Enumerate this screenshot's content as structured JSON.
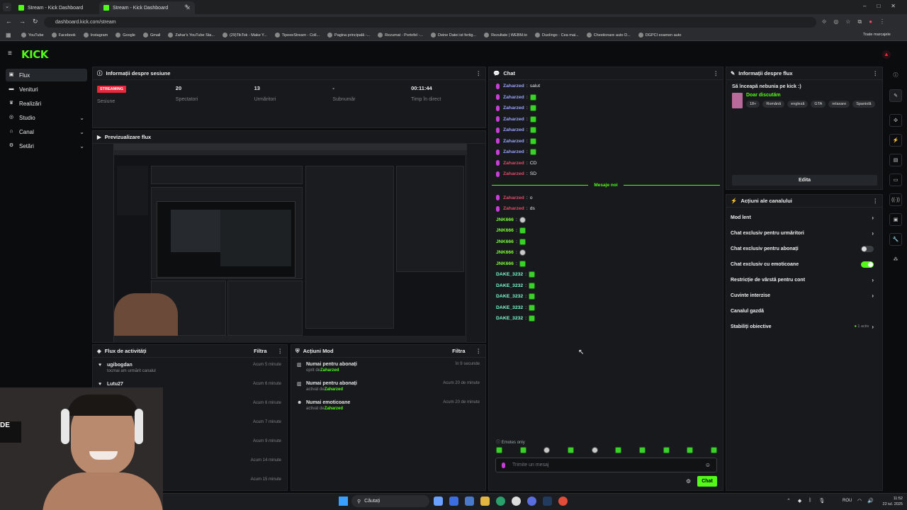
{
  "browser": {
    "tabs": [
      {
        "title": "Stream - Kick Dashboard"
      },
      {
        "title": "Stream - Kick Dashboard"
      }
    ],
    "url": "dashboard.kick.com/stream",
    "bookmarks": [
      "YouTube",
      "Facebook",
      "Instagram",
      "Google",
      "Gmail",
      "Zahar's YouTube Sta...",
      "(29)TikTok - Make Y...",
      "TipeeeStream - Coll...",
      "Pagina principală -...",
      "Rezumat - Portofel -...",
      "Deine Datei ist fertig...",
      "Rezultate | WEBM.to",
      "Duolingo - Cea mai...",
      "Chestionare auto D...",
      "DGPCI examen auto"
    ],
    "all_bookmarks": "Toate marcajele"
  },
  "logo": "KICK",
  "sidebar": [
    {
      "label": "Flux",
      "icon": "stream-icon",
      "active": true,
      "expand": false
    },
    {
      "label": "Venituri",
      "icon": "wallet-icon",
      "active": false,
      "expand": false
    },
    {
      "label": "Realizări",
      "icon": "trophy-icon",
      "active": false,
      "expand": false
    },
    {
      "label": "Studio",
      "icon": "studio-icon",
      "active": false,
      "expand": true
    },
    {
      "label": "Canal",
      "icon": "channel-icon",
      "active": false,
      "expand": true
    },
    {
      "label": "Setări",
      "icon": "gear-icon",
      "active": false,
      "expand": true
    }
  ],
  "session": {
    "title": "Informații despre sesiune",
    "status": "STREAMING",
    "status_label": "Sesiune",
    "viewers": "20",
    "viewers_label": "Spectatori",
    "followers": "13",
    "followers_label": "Urmăritori",
    "subs": "-",
    "subs_label": "Subnumăr",
    "time": "00:11:44",
    "time_label": "Timp în direct"
  },
  "preview": {
    "title": "Previzualizare flux"
  },
  "activity": {
    "title": "Flux de activități",
    "filter": "Filtra",
    "items": [
      {
        "user": "ugibogdan",
        "desc": "tocmai am urmărit canalul",
        "time": "Acum 5 minute"
      },
      {
        "user": "Lutu27",
        "desc": "",
        "time": "Acum 6 minute"
      },
      {
        "user": "",
        "desc": "",
        "time": "Acum 6 minute"
      },
      {
        "user": "",
        "desc": "",
        "time": "Acum 7 minute"
      },
      {
        "user": "",
        "desc": "",
        "time": "Acum 9 minute"
      },
      {
        "user": "",
        "desc": "",
        "time": "Acum 14 minute"
      },
      {
        "user": "",
        "desc": "",
        "time": "Acum 15 minute"
      }
    ]
  },
  "mod": {
    "title": "Acțiuni Mod",
    "filter": "Filtra",
    "items": [
      {
        "action": "Numai pentru abonați",
        "state": "oprit de",
        "by": "Zaharzed",
        "time": "în 9 secunde",
        "icon": "gift-icon"
      },
      {
        "action": "Numai pentru abonați",
        "state": "activat de",
        "by": "Zaharzed",
        "time": "Acum 20 de minute",
        "icon": "gift-icon"
      },
      {
        "action": "Numai emoticoane",
        "state": "activat de",
        "by": "Zaharzed",
        "time": "Acum 20 de minute",
        "icon": "smile-icon"
      }
    ]
  },
  "chat": {
    "title": "Chat",
    "new_messages": "Mesaje noi",
    "messages": [
      {
        "user": "Zaharzed",
        "color": "#9aa3ff",
        "text": "salut",
        "emote": "",
        "mic": true
      },
      {
        "user": "Zaharzed",
        "color": "#9aa3ff",
        "text": "",
        "emote": "frog",
        "mic": true
      },
      {
        "user": "Zaharzed",
        "color": "#9aa3ff",
        "text": "",
        "emote": "frog",
        "mic": true
      },
      {
        "user": "Zaharzed",
        "color": "#9aa3ff",
        "text": "",
        "emote": "frog",
        "mic": true
      },
      {
        "user": "Zaharzed",
        "color": "#9aa3ff",
        "text": "",
        "emote": "frog",
        "mic": true
      },
      {
        "user": "Zaharzed",
        "color": "#9aa3ff",
        "text": "",
        "emote": "frog",
        "mic": true
      },
      {
        "user": "Zaharzed",
        "color": "#9aa3ff",
        "text": "",
        "emote": "frog",
        "mic": true
      },
      {
        "user": "Zaharzed",
        "color": "#e24c6a",
        "text": "CD",
        "emote": "",
        "mic": true
      },
      {
        "user": "Zaharzed",
        "color": "#e24c6a",
        "text": "SD",
        "emote": "",
        "mic": true
      }
    ],
    "messages_after": [
      {
        "user": "Zaharzed",
        "color": "#e24c6a",
        "text": "o",
        "emote": "",
        "mic": true
      },
      {
        "user": "Zaharzed",
        "color": "#e24c6a",
        "text": "ds",
        "emote": "",
        "mic": true
      },
      {
        "user": "JNK666",
        "color": "#7dff3a",
        "text": "",
        "emote": "ball",
        "mic": false
      },
      {
        "user": "JNK666",
        "color": "#7dff3a",
        "text": "",
        "emote": "frog",
        "mic": false
      },
      {
        "user": "JNK666",
        "color": "#7dff3a",
        "text": "",
        "emote": "frog",
        "mic": false
      },
      {
        "user": "JNK666",
        "color": "#7dff3a",
        "text": "",
        "emote": "ball",
        "mic": false
      },
      {
        "user": "JNK666",
        "color": "#7dff3a",
        "text": "",
        "emote": "frog",
        "mic": false
      },
      {
        "user": "DAKE_3232",
        "color": "#7dffd0",
        "text": "",
        "emote": "frog",
        "mic": false
      },
      {
        "user": "DAKE_3232",
        "color": "#7dffd0",
        "text": "",
        "emote": "frog",
        "mic": false
      },
      {
        "user": "DAKE_3232",
        "color": "#7dffd0",
        "text": "",
        "emote": "frog",
        "mic": false
      },
      {
        "user": "DAKE_3232",
        "color": "#7dffd0",
        "text": "",
        "emote": "frog",
        "mic": false
      },
      {
        "user": "DAKE_3232",
        "color": "#7dffd0",
        "text": "",
        "emote": "frog",
        "mic": false
      }
    ],
    "emotes_only": "Emotes only",
    "input_placeholder": "Trimite un mesaj",
    "send": "Chat"
  },
  "stream_info": {
    "title": "Informații despre flux",
    "stream_title": "Să înceapă nebunia pe kick :)",
    "category": "Doar discutăm",
    "tags": [
      "18+",
      "Română",
      "engleză",
      "GTA",
      "relaxare",
      "Spaniolă"
    ],
    "edit": "Edita"
  },
  "channel_actions": {
    "title": "Acțiuni ale canalului",
    "items": [
      {
        "label": "Mod lent",
        "type": "arrow",
        "extra": ""
      },
      {
        "label": "Chat exclusiv pentru urmăritori",
        "type": "arrow",
        "extra": ""
      },
      {
        "label": "Chat exclusiv pentru abonați",
        "type": "toggle-off",
        "extra": ""
      },
      {
        "label": "Chat exclusiv cu emoticoane",
        "type": "toggle-on",
        "extra": ""
      },
      {
        "label": "Restricție de vârstă pentru cont",
        "type": "arrow",
        "extra": ""
      },
      {
        "label": "Cuvinte interzise",
        "type": "arrow",
        "extra": ""
      },
      {
        "label": "Canalul gazdă",
        "type": "none",
        "extra": ""
      },
      {
        "label": "Stabiliți obiective",
        "type": "arrow",
        "extra": "1 activ"
      }
    ]
  },
  "taskbar": {
    "search": "Căutați",
    "lang": "ROU",
    "time": "11:52",
    "date": "22 iul. 2025"
  },
  "colors": {
    "accent": "#53fc18",
    "live": "#e6273d",
    "panel": "#17191c"
  }
}
